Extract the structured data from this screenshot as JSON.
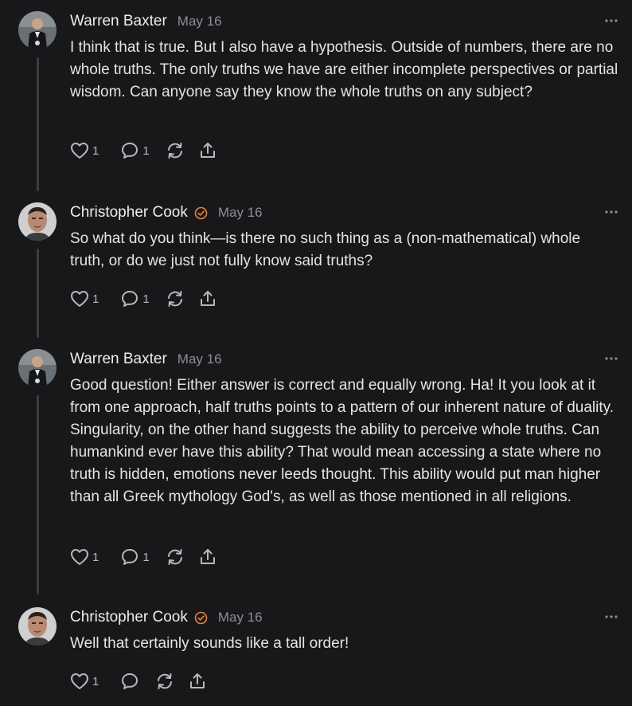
{
  "comments": [
    {
      "author": "Warren Baxter",
      "date": "May 16",
      "verified": false,
      "text": "I think that is true. But I also have a hypothesis. Outside of numbers, there are no whole truths. The only truths we have are either incomplete perspectives or partial wisdom. Can anyone say they know the whole truths on any subject?",
      "likes": "1",
      "replies": "1",
      "more_icon": "more-horizontal-icon"
    },
    {
      "author": "Christopher Cook",
      "date": "May 16",
      "verified": true,
      "text": "So what do you think—is there no such thing as a (non-mathematical) whole truth, or do we just not fully know said truths?",
      "likes": "1",
      "replies": "1",
      "more_icon": "more-horizontal-icon"
    },
    {
      "author": "Warren Baxter",
      "date": "May 16",
      "verified": false,
      "text": "Good question! Either answer is correct and equally wrong. Ha! It you look at it from one approach, half truths points to a pattern of our inherent nature of duality. Singularity, on the other hand suggests the ability to perceive whole truths. Can humankind ever have this ability? That would mean accessing a state where no truth is hidden, emotions never leeds thought. This ability would put man higher than all Greek mythology God's, as well as those mentioned in all religions.",
      "likes": "1",
      "replies": "1",
      "more_icon": "more-horizontal-icon"
    },
    {
      "author": "Christopher Cook",
      "date": "May 16",
      "verified": true,
      "text": "Well that certainly sounds like a tall order!",
      "likes": "1",
      "replies": "",
      "more_icon": "more-horizontal-icon"
    }
  ],
  "colors": {
    "background": "#18181a",
    "verified_badge": "#e8823a",
    "thread_line": "#3d3d40",
    "muted_text": "#8e8e93"
  },
  "icons": [
    "heart-icon",
    "comment-icon",
    "restack-icon",
    "share-icon",
    "verified-badge-icon"
  ]
}
